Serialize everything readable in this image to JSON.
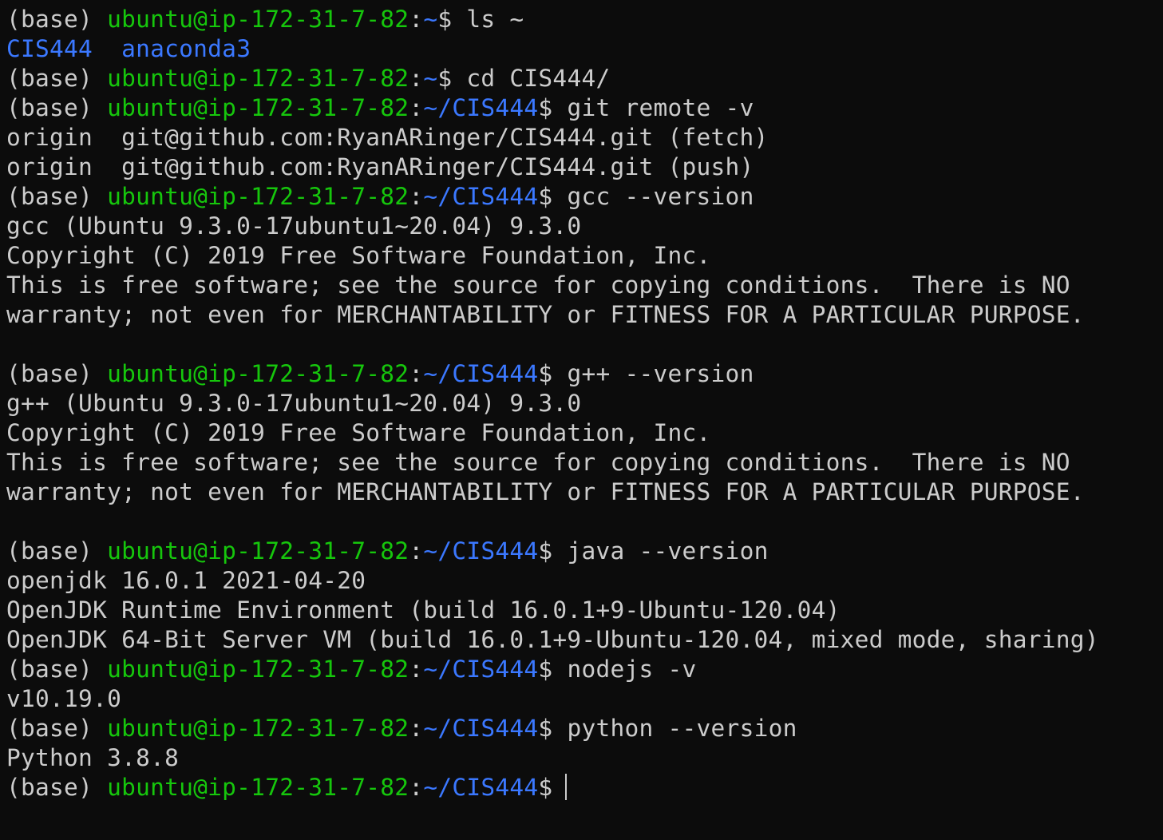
{
  "colors": {
    "background": "#0c0c0c",
    "text": "#cccccc",
    "user_host": "#16c60c",
    "path": "#3b78ff"
  },
  "lines": [
    [
      {
        "t": "(base) ",
        "c": "default"
      },
      {
        "t": "ubuntu@ip-172-31-7-82",
        "c": "green"
      },
      {
        "t": ":",
        "c": "default"
      },
      {
        "t": "~",
        "c": "blue"
      },
      {
        "t": "$ ls ~",
        "c": "default"
      }
    ],
    [
      {
        "t": "CIS444",
        "c": "blue"
      },
      {
        "t": "  ",
        "c": "default"
      },
      {
        "t": "anaconda3",
        "c": "blue"
      }
    ],
    [
      {
        "t": "(base) ",
        "c": "default"
      },
      {
        "t": "ubuntu@ip-172-31-7-82",
        "c": "green"
      },
      {
        "t": ":",
        "c": "default"
      },
      {
        "t": "~",
        "c": "blue"
      },
      {
        "t": "$ cd CIS444/",
        "c": "default"
      }
    ],
    [
      {
        "t": "(base) ",
        "c": "default"
      },
      {
        "t": "ubuntu@ip-172-31-7-82",
        "c": "green"
      },
      {
        "t": ":",
        "c": "default"
      },
      {
        "t": "~/CIS444",
        "c": "blue"
      },
      {
        "t": "$ git remote -v",
        "c": "default"
      }
    ],
    [
      {
        "t": "origin  git@github.com:RyanARinger/CIS444.git (fetch)",
        "c": "default"
      }
    ],
    [
      {
        "t": "origin  git@github.com:RyanARinger/CIS444.git (push)",
        "c": "default"
      }
    ],
    [
      {
        "t": "(base) ",
        "c": "default"
      },
      {
        "t": "ubuntu@ip-172-31-7-82",
        "c": "green"
      },
      {
        "t": ":",
        "c": "default"
      },
      {
        "t": "~/CIS444",
        "c": "blue"
      },
      {
        "t": "$ gcc --version",
        "c": "default"
      }
    ],
    [
      {
        "t": "gcc (Ubuntu 9.3.0-17ubuntu1~20.04) 9.3.0",
        "c": "default"
      }
    ],
    [
      {
        "t": "Copyright (C) 2019 Free Software Foundation, Inc.",
        "c": "default"
      }
    ],
    [
      {
        "t": "This is free software; see the source for copying conditions.  There is NO",
        "c": "default"
      }
    ],
    [
      {
        "t": "warranty; not even for MERCHANTABILITY or FITNESS FOR A PARTICULAR PURPOSE.",
        "c": "default"
      }
    ],
    [],
    [
      {
        "t": "(base) ",
        "c": "default"
      },
      {
        "t": "ubuntu@ip-172-31-7-82",
        "c": "green"
      },
      {
        "t": ":",
        "c": "default"
      },
      {
        "t": "~/CIS444",
        "c": "blue"
      },
      {
        "t": "$ g++ --version",
        "c": "default"
      }
    ],
    [
      {
        "t": "g++ (Ubuntu 9.3.0-17ubuntu1~20.04) 9.3.0",
        "c": "default"
      }
    ],
    [
      {
        "t": "Copyright (C) 2019 Free Software Foundation, Inc.",
        "c": "default"
      }
    ],
    [
      {
        "t": "This is free software; see the source for copying conditions.  There is NO",
        "c": "default"
      }
    ],
    [
      {
        "t": "warranty; not even for MERCHANTABILITY or FITNESS FOR A PARTICULAR PURPOSE.",
        "c": "default"
      }
    ],
    [],
    [
      {
        "t": "(base) ",
        "c": "default"
      },
      {
        "t": "ubuntu@ip-172-31-7-82",
        "c": "green"
      },
      {
        "t": ":",
        "c": "default"
      },
      {
        "t": "~/CIS444",
        "c": "blue"
      },
      {
        "t": "$ java --version",
        "c": "default"
      }
    ],
    [
      {
        "t": "openjdk 16.0.1 2021-04-20",
        "c": "default"
      }
    ],
    [
      {
        "t": "OpenJDK Runtime Environment (build 16.0.1+9-Ubuntu-120.04)",
        "c": "default"
      }
    ],
    [
      {
        "t": "OpenJDK 64-Bit Server VM (build 16.0.1+9-Ubuntu-120.04, mixed mode, sharing)",
        "c": "default"
      }
    ],
    [
      {
        "t": "(base) ",
        "c": "default"
      },
      {
        "t": "ubuntu@ip-172-31-7-82",
        "c": "green"
      },
      {
        "t": ":",
        "c": "default"
      },
      {
        "t": "~/CIS444",
        "c": "blue"
      },
      {
        "t": "$ nodejs -v",
        "c": "default"
      }
    ],
    [
      {
        "t": "v10.19.0",
        "c": "default"
      }
    ],
    [
      {
        "t": "(base) ",
        "c": "default"
      },
      {
        "t": "ubuntu@ip-172-31-7-82",
        "c": "green"
      },
      {
        "t": ":",
        "c": "default"
      },
      {
        "t": "~/CIS444",
        "c": "blue"
      },
      {
        "t": "$ python --version",
        "c": "default"
      }
    ],
    [
      {
        "t": "Python 3.8.8",
        "c": "default"
      }
    ],
    [
      {
        "t": "(base) ",
        "c": "default"
      },
      {
        "t": "ubuntu@ip-172-31-7-82",
        "c": "green"
      },
      {
        "t": ":",
        "c": "default"
      },
      {
        "t": "~/CIS444",
        "c": "blue"
      },
      {
        "t": "$",
        "c": "default"
      }
    ]
  ],
  "cursor_line": 26
}
